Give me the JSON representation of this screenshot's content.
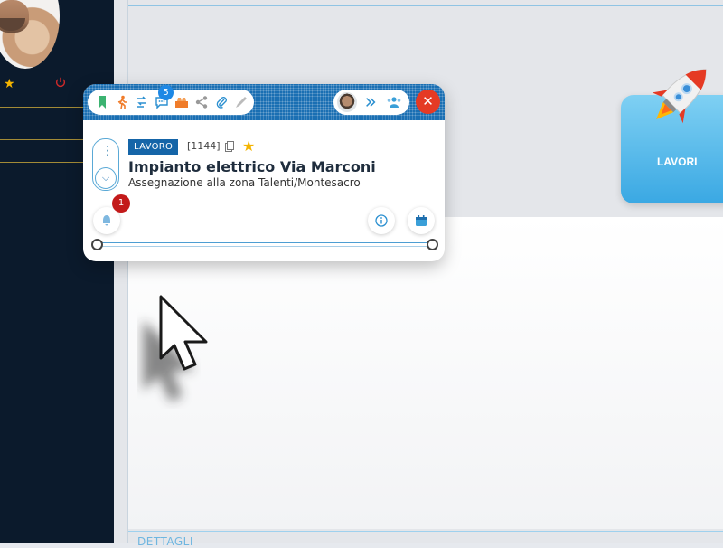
{
  "sidebar": {
    "avatar_alt": "user-avatar",
    "favorite_icon": "star-icon",
    "logout_icon": "power-icon"
  },
  "main": {
    "section_label": "DETTAGLI",
    "tile": {
      "label": "LAVORI",
      "icon": "rocket-icon",
      "color": "#3aa8e3"
    }
  },
  "card": {
    "toolbar": {
      "icons": [
        "bookmark-icon",
        "walking-icon",
        "route-icon",
        "chat-icon",
        "tool-icon",
        "share-icon",
        "attachment-icon",
        "pen-icon"
      ],
      "chat_badge": "5"
    },
    "assignee_icons": [
      "avatar",
      "forward-icon",
      "group-icon"
    ],
    "close_label": "✕",
    "tag": "LAVORO",
    "code": "[1144]",
    "title": "Impianto elettrico Via Marconi",
    "subtitle": "Assegnazione alla zona Talenti/Montesacro",
    "notifications_badge": "1",
    "footer_icons": [
      "bell-icon",
      "info-icon",
      "calendar-icon"
    ]
  },
  "colors": {
    "sidebar_bg": "#0b1a2c",
    "header_blue": "#1a6fb3",
    "close_red": "#e53a24",
    "badge_red": "#c31a1a",
    "star": "#f4b400"
  }
}
